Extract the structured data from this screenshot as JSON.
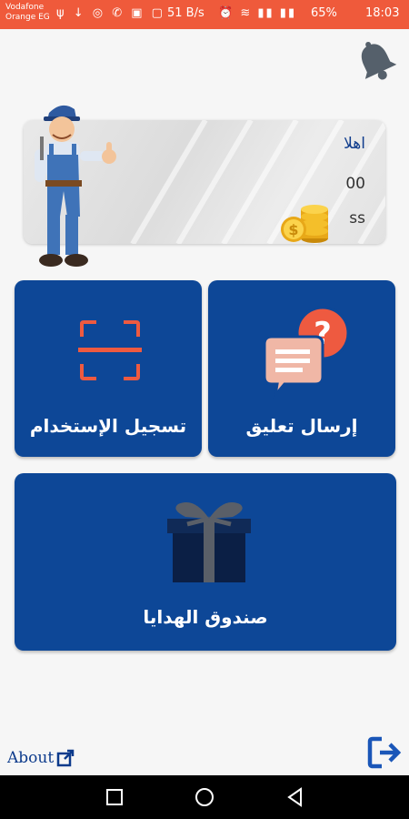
{
  "status_bar": {
    "carrier_line1": "Vodafone",
    "carrier_line2": "Orange EG",
    "notification_icons": "ψ ↓ ◎ ✆ ▣ ▢",
    "net_speed": "51 B/s",
    "right_icons": "⏰ ≋ ▮▮ ▮▮",
    "battery": "65%",
    "time": "18:03"
  },
  "header": {
    "bell_icon": "bell-icon"
  },
  "welcome_card": {
    "greeting": "اهلا",
    "points": "00",
    "username": "ss"
  },
  "tiles": {
    "feedback": {
      "label": "إرسال تعليق",
      "icon": "chat-question-icon"
    },
    "scan_login": {
      "label": "تسجيل الإستخدام",
      "icon": "scan-frame-icon"
    },
    "gift_box": {
      "label": "صندوق الهدايا",
      "icon": "gift-box-icon"
    }
  },
  "footer": {
    "about_label": "About",
    "logout_icon": "logout-icon"
  },
  "colors": {
    "status_bar": "#ef5a3b",
    "tile_blue": "#0d4797",
    "accent_orange": "#ee5a40",
    "link_blue": "#0d3b8c"
  }
}
